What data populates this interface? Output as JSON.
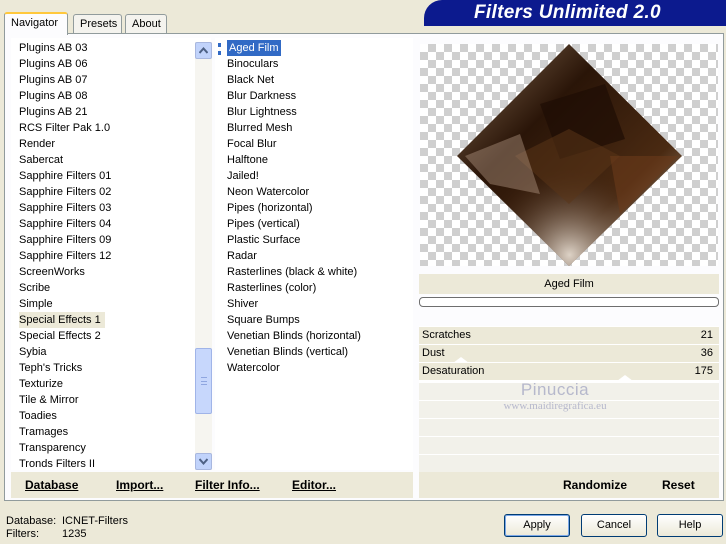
{
  "tabs": [
    "Navigator",
    "Presets",
    "About"
  ],
  "banner": "Filters Unlimited 2.0",
  "categories": [
    "Plugins AB 03",
    "Plugins AB 06",
    "Plugins AB 07",
    "Plugins AB 08",
    "Plugins AB 21",
    "RCS Filter Pak 1.0",
    "Render",
    "Sabercat",
    "Sapphire Filters 01",
    "Sapphire Filters 02",
    "Sapphire Filters 03",
    "Sapphire Filters 04",
    "Sapphire Filters 09",
    "Sapphire Filters 12",
    "ScreenWorks",
    "Scribe",
    "Simple",
    "Special Effects 1",
    "Special Effects 2",
    "Sybia",
    "Teph's Tricks",
    "Texturize",
    "Tile & Mirror",
    "Toadies",
    "Tramages",
    "Transparency",
    "Tronds Filters II"
  ],
  "selected_category": "Special Effects 1",
  "filters": [
    "Aged Film",
    "Binoculars",
    "Black Net",
    "Blur Darkness",
    "Blur Lightness",
    "Blurred Mesh",
    "Focal Blur",
    "Halftone",
    "Jailed!",
    "Neon Watercolor",
    "Pipes (horizontal)",
    "Pipes (vertical)",
    "Plastic Surface",
    "Radar",
    "Rasterlines (black & white)",
    "Rasterlines (color)",
    "Shiver",
    "Square Bumps",
    "Venetian Blinds (horizontal)",
    "Venetian Blinds (vertical)",
    "Watercolor"
  ],
  "selected_filter": "Aged Film",
  "preview_filter_name": "Aged Film",
  "params": [
    {
      "name": "Scratches",
      "value": "21"
    },
    {
      "name": "Dust",
      "value": "36"
    },
    {
      "name": "Desaturation",
      "value": "175"
    }
  ],
  "watermark": {
    "line1": "Pinuccia",
    "line2": "www.maidiregrafica.eu"
  },
  "left_buttons": [
    "Database",
    "Import...",
    "Filter Info...",
    "Editor..."
  ],
  "right_buttons": [
    "Randomize",
    "Reset"
  ],
  "status": {
    "database_label": "Database:",
    "database_value": "ICNET-Filters",
    "filters_label": "Filters:",
    "filters_value": "1235"
  },
  "dialog_buttons": {
    "apply": "Apply",
    "cancel": "Cancel",
    "help": "Help"
  },
  "colors": {
    "banner": "#0c1a8e",
    "selection": "#316ac5",
    "window_bg": "#ece9d8"
  },
  "icons": [
    "scroll-up-arrow-icon",
    "scroll-down-arrow-icon",
    "list-marker-icon"
  ]
}
